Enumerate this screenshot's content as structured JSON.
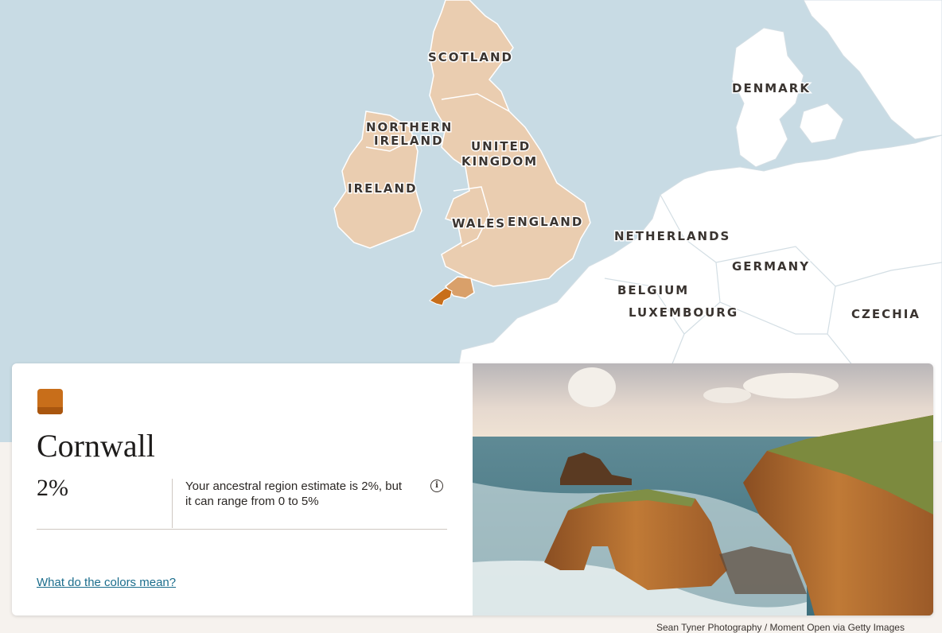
{
  "map": {
    "colors": {
      "water": "#c8dbe4",
      "land": "#ffffff",
      "region": "#eacdb0",
      "highlight": "#d9a06a",
      "selected": "#c86e1a",
      "border": "#d3dee4"
    },
    "labels": {
      "scotland": "SCOTLAND",
      "northern_ireland_1": "NORTHERN",
      "northern_ireland_2": "IRELAND",
      "ireland": "IRELAND",
      "uk_1": "UNITED",
      "uk_2": "KINGDOM",
      "wales": "WALES",
      "england": "ENGLAND",
      "denmark": "DENMARK",
      "netherlands": "NETHERLANDS",
      "germany": "GERMANY",
      "belgium": "BELGIUM",
      "luxembourg": "LUXEMBOURG",
      "czechia": "CZECHIA"
    }
  },
  "region": {
    "swatch_color": "#c86e1a",
    "name": "Cornwall",
    "percent": "2%",
    "description": "Your ancestral region estimate is 2%, but it can range from 0 to 5%",
    "info_icon": "info-icon",
    "colors_link": "What do the colors mean?"
  },
  "photo": {
    "credit": "Sean Tyner Photography / Moment Open via Getty Images"
  }
}
